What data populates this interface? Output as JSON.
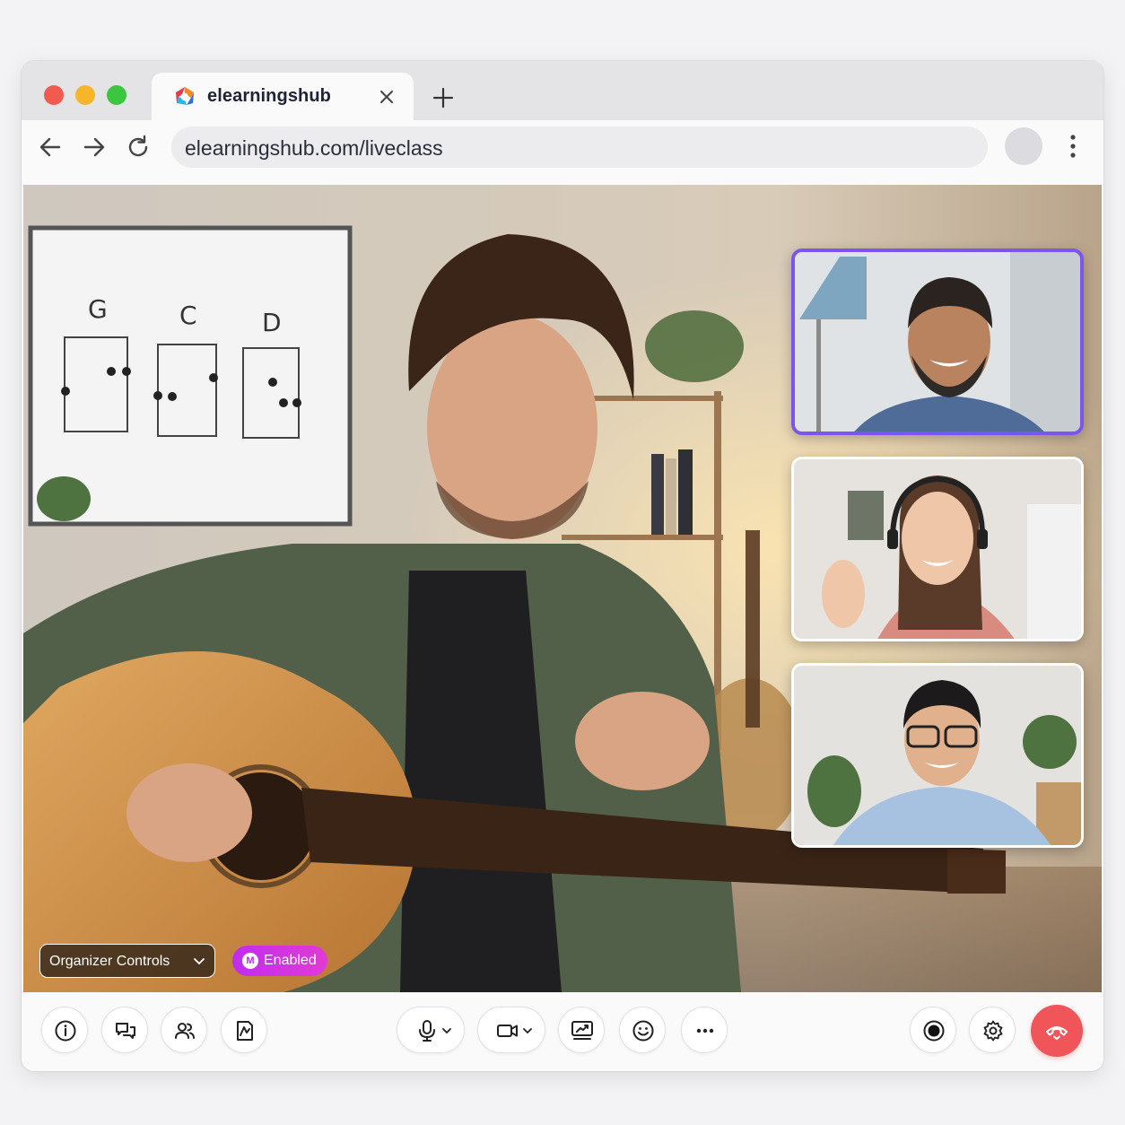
{
  "browser": {
    "tab": {
      "title": "elearningshub"
    },
    "url": "elearningshub.com/liveclass"
  },
  "main_video": {
    "whiteboard_chords": [
      "G",
      "C",
      "D"
    ]
  },
  "overlay": {
    "organizer_controls_label": "Organizer Controls",
    "enabled_badge_label": "Enabled",
    "enabled_badge_icon_letter": "M"
  },
  "toolbar": {
    "left_icons": [
      "info-icon",
      "chat-icon",
      "participants-icon",
      "whiteboard-icon"
    ],
    "center_icons": [
      "microphone-icon",
      "camera-icon",
      "share-screen-icon",
      "emoji-icon",
      "more-icon"
    ],
    "right_icons": [
      "record-icon",
      "settings-icon",
      "end-call-icon"
    ]
  },
  "colors": {
    "accent": "#7b55ee",
    "end_call": "#f0555a",
    "badge": "#c02cf0"
  }
}
